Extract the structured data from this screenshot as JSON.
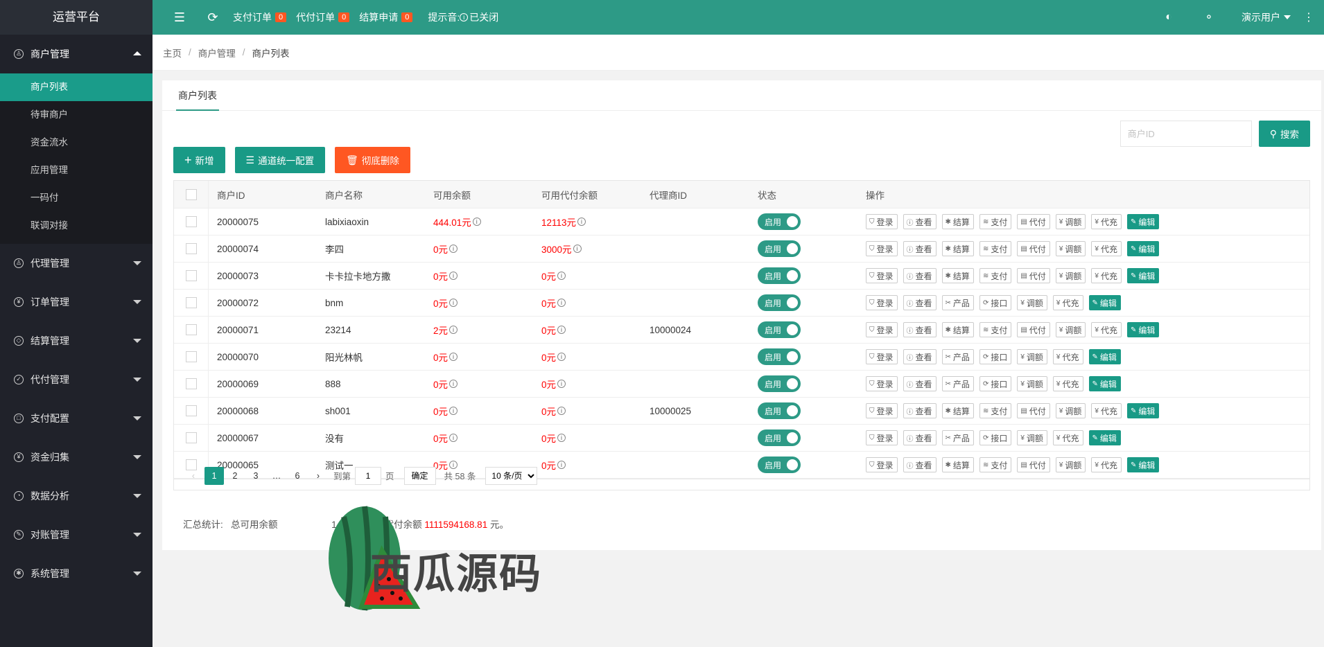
{
  "app": {
    "title": "运营平台"
  },
  "topbar": {
    "links": [
      {
        "label": "支付订单",
        "count": "0"
      },
      {
        "label": "代付订单",
        "count": "0"
      },
      {
        "label": "结算申请",
        "count": "0"
      }
    ],
    "sound_label": "提示音:",
    "sound_state": "已关闭",
    "user": "演示用户"
  },
  "sidebar": {
    "groups": [
      {
        "label": "商户管理",
        "icon": "user-icon",
        "expanded": true
      },
      {
        "label": "代理管理",
        "icon": "person-icon"
      },
      {
        "label": "订单管理",
        "icon": "yen-icon"
      },
      {
        "label": "结算管理",
        "icon": "diamond-icon"
      },
      {
        "label": "代付管理",
        "icon": "shield-icon"
      },
      {
        "label": "支付配置",
        "icon": "box-icon"
      },
      {
        "label": "资金归集",
        "icon": "yen-circle-icon"
      },
      {
        "label": "数据分析",
        "icon": "gauge-icon"
      },
      {
        "label": "对账管理",
        "icon": "edit-icon"
      },
      {
        "label": "系统管理",
        "icon": "gear-icon"
      }
    ],
    "sub_items": [
      "商户列表",
      "待审商户",
      "资金流水",
      "应用管理",
      "一码付",
      "联调对接"
    ]
  },
  "breadcrumb": {
    "home": "主页",
    "section": "商户管理",
    "current": "商户列表"
  },
  "tab": "商户列表",
  "search": {
    "placeholder": "商户ID",
    "button": "搜索"
  },
  "actions": {
    "add": "新增",
    "channel": "通道统一配置",
    "delete": "彻底删除"
  },
  "table": {
    "headers": [
      "商户ID",
      "商户名称",
      "可用余额",
      "可用代付余额",
      "代理商ID",
      "状态",
      "操作"
    ],
    "status_label": "启用",
    "ops_full": [
      "登录",
      "查看",
      "结算",
      "支付",
      "代付",
      "调额",
      "代充",
      "编辑"
    ],
    "ops_short": [
      "登录",
      "查看",
      "产品",
      "接口",
      "调额",
      "代充",
      "编辑"
    ],
    "rows": [
      {
        "id": "20000075",
        "name": "labixiaoxin",
        "balance": "444.01元",
        "pay_balance": "12113元",
        "agent": "",
        "full": true
      },
      {
        "id": "20000074",
        "name": "李四",
        "balance": "0元",
        "pay_balance": "3000元",
        "agent": "",
        "full": true
      },
      {
        "id": "20000073",
        "name": "卡卡拉卡地方撒",
        "balance": "0元",
        "pay_balance": "0元",
        "agent": "",
        "full": true
      },
      {
        "id": "20000072",
        "name": "bnm",
        "balance": "0元",
        "pay_balance": "0元",
        "agent": "",
        "full": false
      },
      {
        "id": "20000071",
        "name": "23214",
        "balance": "2元",
        "pay_balance": "0元",
        "agent": "10000024",
        "full": true
      },
      {
        "id": "20000070",
        "name": "阳光林帆",
        "balance": "0元",
        "pay_balance": "0元",
        "agent": "",
        "full": false
      },
      {
        "id": "20000069",
        "name": "888",
        "balance": "0元",
        "pay_balance": "0元",
        "agent": "",
        "full": false
      },
      {
        "id": "20000068",
        "name": "sh001",
        "balance": "0元",
        "pay_balance": "0元",
        "agent": "10000025",
        "full": true
      },
      {
        "id": "20000067",
        "name": "没有",
        "balance": "0元",
        "pay_balance": "0元",
        "agent": "",
        "full": false
      },
      {
        "id": "20000065",
        "name": "测试一",
        "balance": "0元",
        "pay_balance": "0元",
        "agent": "",
        "full": true
      }
    ]
  },
  "pager": {
    "pages": [
      "1",
      "2",
      "3",
      "…",
      "6"
    ],
    "goto_label": "到第",
    "goto_value": "1",
    "page_unit": "页",
    "confirm": "确定",
    "total": "共 58 条",
    "per_page": "10 条/页"
  },
  "summary": {
    "label": "汇总统计:",
    "total_label": "总可用余额",
    "total_suffix": "1 元,",
    "pay_label": "总可用代付余额",
    "pay_value": "1111594168.81",
    "pay_suffix": "元。"
  },
  "watermark": "西瓜源码"
}
